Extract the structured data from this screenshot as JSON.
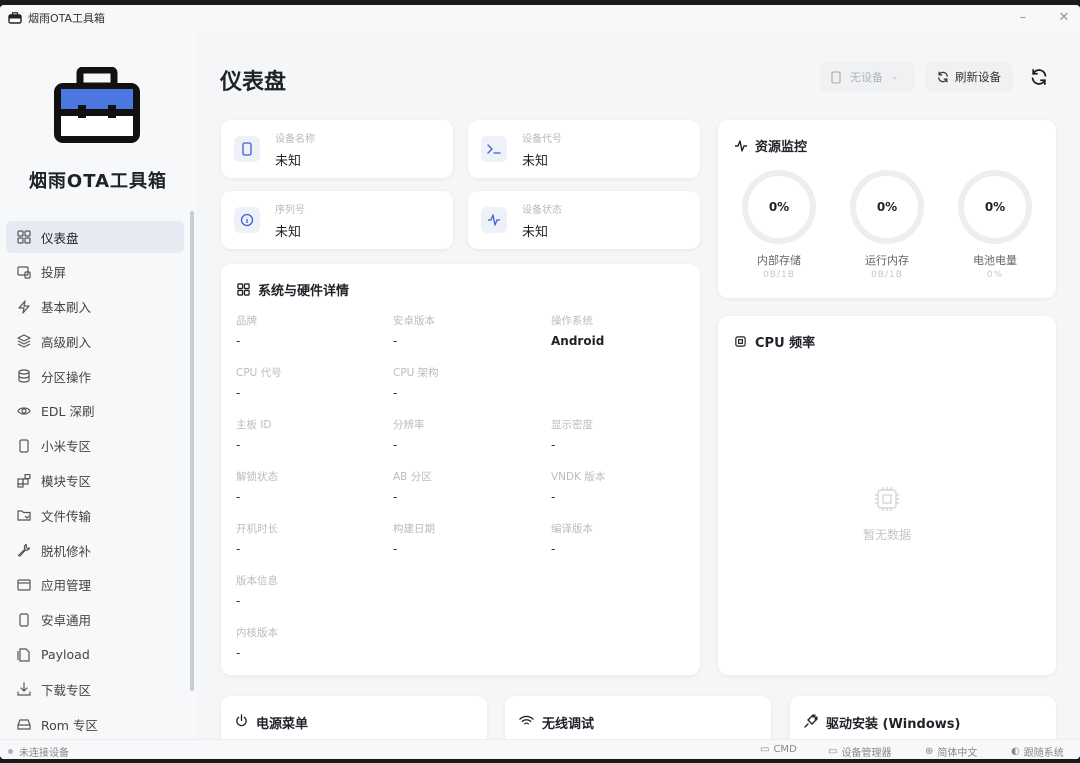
{
  "window": {
    "title": "烟雨OTA工具箱"
  },
  "sidebar": {
    "brand": "烟雨OTA工具箱",
    "items": [
      {
        "label": "仪表盘",
        "icon": "grid-icon"
      },
      {
        "label": "投屏",
        "icon": "screencast-icon"
      },
      {
        "label": "基本刷入",
        "icon": "lightning-icon"
      },
      {
        "label": "高级刷入",
        "icon": "layers-icon"
      },
      {
        "label": "分区操作",
        "icon": "database-icon"
      },
      {
        "label": "EDL 深刷",
        "icon": "eye-icon"
      },
      {
        "label": "小米专区",
        "icon": "phone-icon"
      },
      {
        "label": "模块专区",
        "icon": "blocks-icon"
      },
      {
        "label": "文件传输",
        "icon": "folder-icon"
      },
      {
        "label": "脱机修补",
        "icon": "wrench-icon"
      },
      {
        "label": "应用管理",
        "icon": "window-icon"
      },
      {
        "label": "安卓通用",
        "icon": "phone-icon"
      },
      {
        "label": "Payload",
        "icon": "file-icon"
      },
      {
        "label": "下载专区",
        "icon": "download-icon"
      },
      {
        "label": "Rom 专区",
        "icon": "drive-icon"
      }
    ]
  },
  "header": {
    "title": "仪表盘",
    "device_select": "无设备",
    "refresh_label": "刷新设备"
  },
  "info_cards": [
    {
      "label": "设备名称",
      "value": "未知",
      "icon": "phone-icon"
    },
    {
      "label": "设备代号",
      "value": "未知",
      "icon": "terminal-icon"
    },
    {
      "label": "序列号",
      "value": "未知",
      "icon": "info-icon"
    },
    {
      "label": "设备状态",
      "value": "未知",
      "icon": "pulse-icon"
    }
  ],
  "details": {
    "title": "系统与硬件详情",
    "specs": [
      {
        "label": "品牌",
        "value": "-"
      },
      {
        "label": "安卓版本",
        "value": "-"
      },
      {
        "label": "操作系统",
        "value": "Android"
      },
      {
        "label": "CPU 代号",
        "value": "-"
      },
      {
        "label": "CPU 架构",
        "value": "-"
      },
      {
        "label": "主板 ID",
        "value": "-"
      },
      {
        "label": "分辨率",
        "value": "-"
      },
      {
        "label": "显示密度",
        "value": "-"
      },
      {
        "label": "解锁状态",
        "value": "-"
      },
      {
        "label": "AB 分区",
        "value": "-"
      },
      {
        "label": "VNDK 版本",
        "value": "-"
      },
      {
        "label": "开机时长",
        "value": "-"
      },
      {
        "label": "构建日期",
        "value": "-"
      },
      {
        "label": "编译版本",
        "value": "-"
      },
      {
        "label": "版本信息",
        "value": "-"
      },
      {
        "label": "内核版本",
        "value": "-"
      }
    ]
  },
  "monitor": {
    "title": "资源监控",
    "rings": [
      {
        "value": "0%",
        "label": "内部存储",
        "sub": "0B/1B",
        "fraction": 0
      },
      {
        "value": "0%",
        "label": "运行内存",
        "sub": "0B/1B",
        "fraction": 0
      },
      {
        "value": "0%",
        "label": "电池电量",
        "sub": "0%",
        "fraction": 0
      }
    ]
  },
  "cpu": {
    "title": "CPU 频率",
    "empty": "暂无数据"
  },
  "bottom_cards": [
    {
      "title": "电源菜单",
      "icon": "power-icon"
    },
    {
      "title": "无线调试",
      "icon": "wifi-icon"
    },
    {
      "title": "驱动安装 (Windows)",
      "icon": "plug-icon"
    }
  ],
  "status": {
    "connection": "未连接设备",
    "cmd": "CMD",
    "device_manager": "设备管理器",
    "language": "简体中文",
    "theme": "跟随系统"
  },
  "colors": {
    "accent": "#3e5fd8",
    "logo_blue": "#4a78e0"
  }
}
